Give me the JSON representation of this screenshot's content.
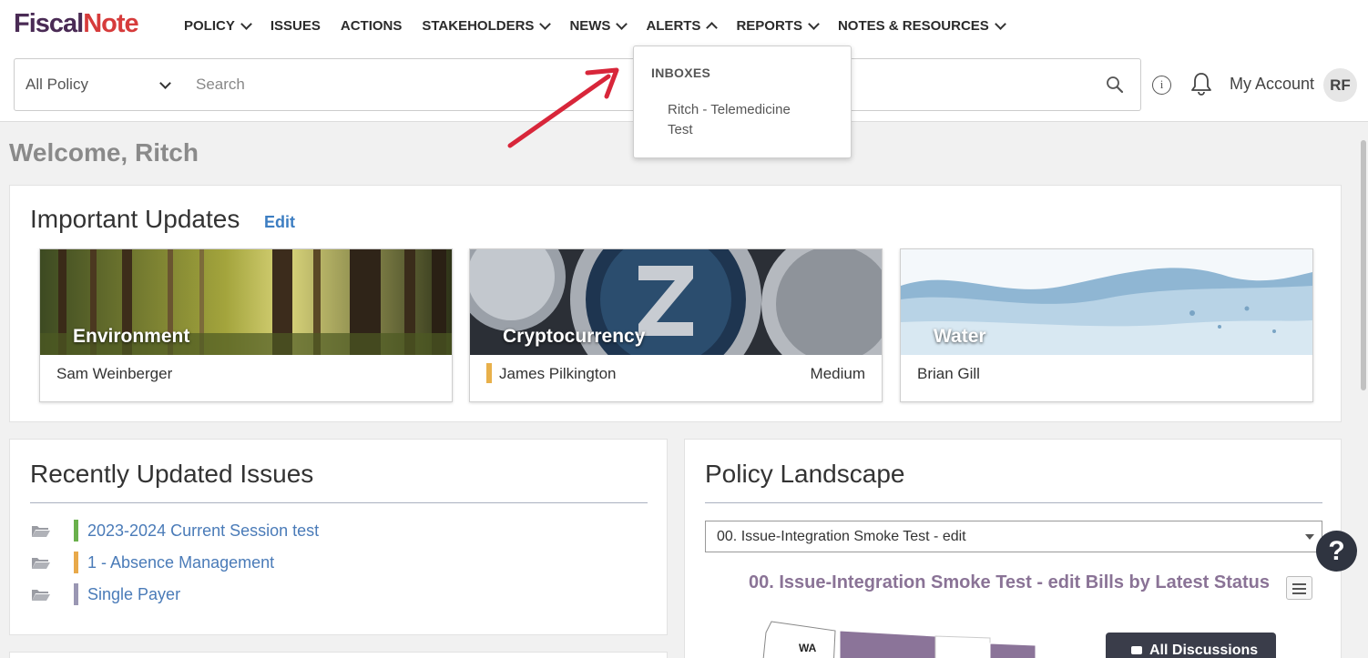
{
  "header": {
    "logo_part1": "Fiscal",
    "logo_part2": "Note",
    "menu": [
      {
        "label": "POLICY",
        "chevron": "down"
      },
      {
        "label": "ISSUES",
        "chevron": ""
      },
      {
        "label": "ACTIONS",
        "chevron": ""
      },
      {
        "label": "STAKEHOLDERS",
        "chevron": "down"
      },
      {
        "label": "NEWS",
        "chevron": "down"
      },
      {
        "label": "ALERTS",
        "chevron": "up"
      },
      {
        "label": "REPORTS",
        "chevron": "down"
      },
      {
        "label": "NOTES & RESOURCES",
        "chevron": "down"
      }
    ]
  },
  "search": {
    "scope": "All Policy",
    "placeholder": "Search"
  },
  "account": {
    "info_glyph": "i",
    "label": "My Account",
    "initials": "RF"
  },
  "alerts_dropdown": {
    "heading": "INBOXES",
    "items": [
      "Ritch - Telemedicine Test"
    ]
  },
  "welcome": "Welcome, Ritch",
  "important_updates": {
    "title": "Important Updates",
    "edit": "Edit",
    "cards": [
      {
        "label": "Environment",
        "owner": "Sam Weinberger",
        "priority": ""
      },
      {
        "label": "Cryptocurrency",
        "owner": "James Pilkington",
        "priority": "Medium"
      },
      {
        "label": "Water",
        "owner": "Brian Gill",
        "priority": ""
      }
    ]
  },
  "recent_issues": {
    "title": "Recently Updated Issues",
    "items": [
      {
        "label": "2023-2024 Current Session test",
        "color": "#6ab04c"
      },
      {
        "label": "1 - Absence Management",
        "color": "#e8a94a"
      },
      {
        "label": "Single Payer",
        "color": "#9a97b3"
      }
    ]
  },
  "policy_landscape": {
    "title": "Policy Landscape",
    "selected": "00. Issue-Integration Smoke Test - edit",
    "chart_title": "00. Issue-Integration Smoke Test - edit Bills by Latest Status",
    "map_state": "WA",
    "discussions_button": "All Discussions"
  },
  "help_glyph": "?",
  "colors": {
    "brand_purple": "#4a2b55",
    "brand_red": "#d63b3b",
    "link_blue": "#4a7bb8",
    "map_purple": "#8b7499",
    "dark_button": "#3a3d4a"
  }
}
